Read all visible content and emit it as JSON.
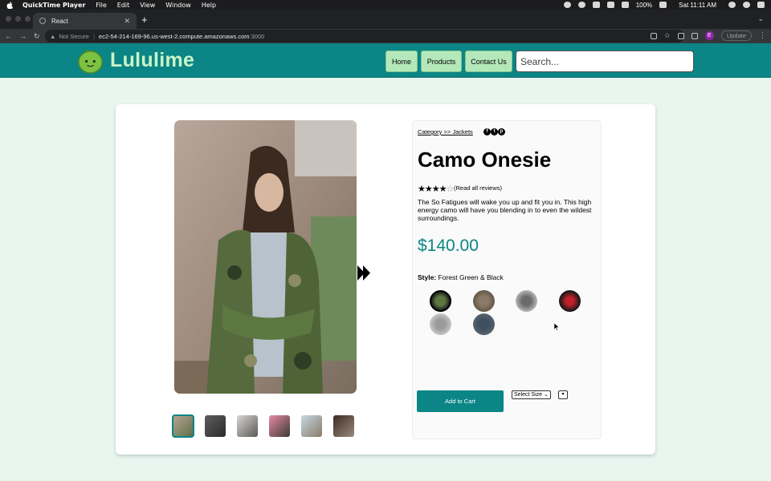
{
  "menubar": {
    "app_name": "QuickTime Player",
    "items": [
      "File",
      "Edit",
      "View",
      "Window",
      "Help"
    ],
    "battery": "100%",
    "clock": "Sat 11:11 AM"
  },
  "browser": {
    "tab_title": "React",
    "new_tab": "+",
    "security_label": "Not Secure",
    "url_host": "ec2-54-214-169-96.us-west-2.compute.amazonaws.com",
    "url_port": ":3000",
    "profile_initial": "E",
    "update_label": "Update"
  },
  "site": {
    "brand": "Lululime",
    "nav": [
      "Home",
      "Products",
      "Contact Us"
    ],
    "search_placeholder": "Search..."
  },
  "product": {
    "breadcrumb": "Category >> Jackets",
    "title": "Camo Onesie",
    "rating": 4,
    "rating_max": 5,
    "stars_filled": "★★★★",
    "stars_empty": "☆",
    "reviews_link": "(Read all reviews)",
    "description": "The So Fatigues will wake you up and fit you in. This high energy camo will have you blending in to even the wildest surroundings.",
    "price": "$140.00",
    "style_label": "Style:",
    "style_value": "Forest Green & Black",
    "add_to_cart": "Add to Cart",
    "size_select": "Select Size",
    "qty_select": "▾"
  },
  "colors": {
    "brand_teal": "#0b8585",
    "nav_button": "#b4e8bb",
    "logo_text": "#c9f4c7",
    "page_bg": "#e7f7f0"
  }
}
